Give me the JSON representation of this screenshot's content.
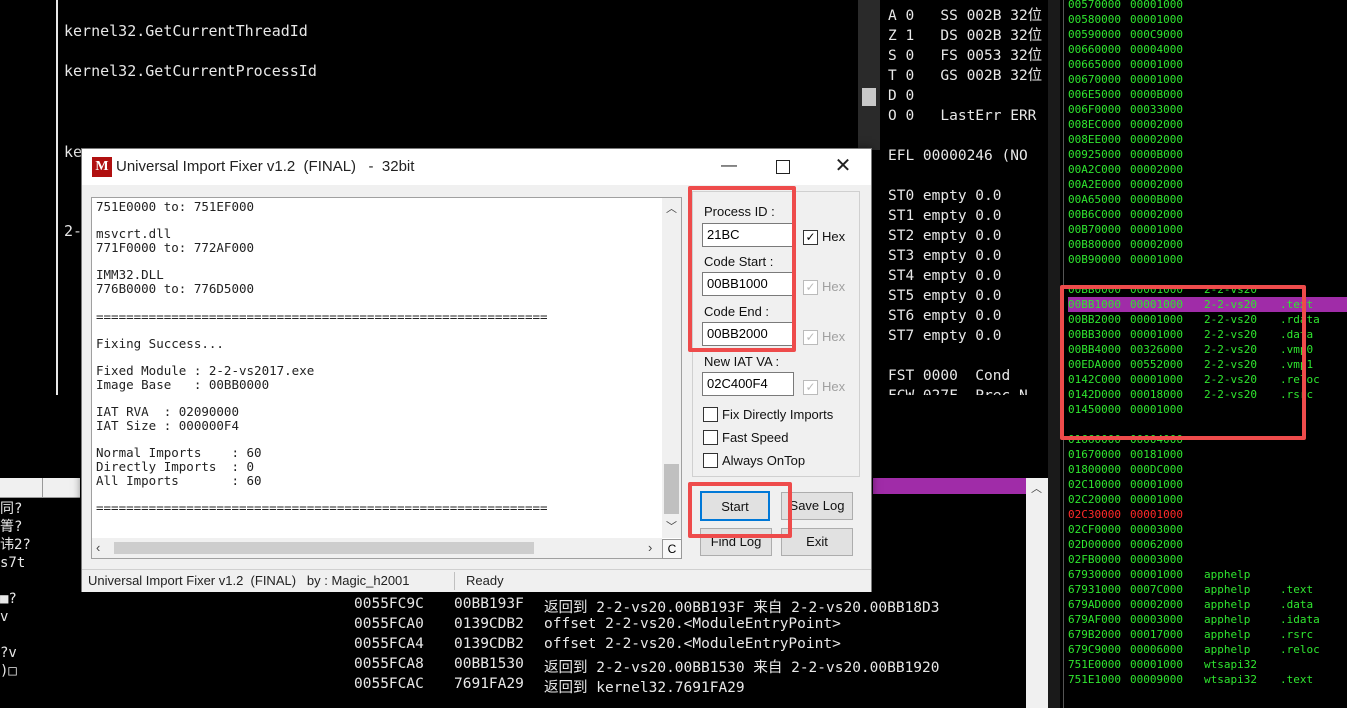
{
  "background": {
    "top_left_lines": [
      "kernel32.GetCurrentThreadId",
      "kernel32.GetCurrentProcessId"
    ],
    "partial_left": [
      "ke",
      "2-"
    ],
    "registers": [
      "A 0   SS 002B 32位",
      "Z 1   DS 002B 32位",
      "S 0   FS 0053 32位",
      "T 0   GS 002B 32位",
      "D 0",
      "O 0   LastErr ERR",
      "",
      "EFL 00000246 (NO",
      "",
      "ST0 empty 0.0",
      "ST1 empty 0.0",
      "ST2 empty 0.0",
      "ST3 empty 0.0",
      "ST4 empty 0.0",
      "ST5 empty 0.0",
      "ST6 empty 0.0",
      "ST7 empty 0.0",
      "",
      "FST 0000  Cond",
      "FCW 027F  Prec N"
    ],
    "stack_rows": [
      {
        "addr": "0055FC9C",
        "val": "00BB193F",
        "text": "返回到 2-2-vs20.00BB193F 来自 2-2-vs20.00BB18D3"
      },
      {
        "addr": "0055FCA0",
        "val": "0139CDB2",
        "text": "offset 2-2-vs20.<ModuleEntryPoint>"
      },
      {
        "addr": "0055FCA4",
        "val": "0139CDB2",
        "text": "offset 2-2-vs20.<ModuleEntryPoint>"
      },
      {
        "addr": "0055FCA8",
        "val": "00BB1530",
        "text": "返回到 2-2-vs20.00BB1530 来自 2-2-vs20.00BB1920"
      },
      {
        "addr": "0055FCAC",
        "val": "7691FA29",
        "text": "返回到 kernel32.7691FA29"
      }
    ],
    "left_bottom_chars": [
      "同?",
      "箐?",
      "讳2?",
      "s7t",
      "",
      "■?",
      "v",
      "",
      "?v",
      ")□"
    ],
    "memory_rows": [
      {
        "a": "00570000",
        "b": "00001000",
        "c": "",
        "d": ""
      },
      {
        "a": "00580000",
        "b": "00001000",
        "c": "",
        "d": ""
      },
      {
        "a": "00590000",
        "b": "000C9000",
        "c": "",
        "d": ""
      },
      {
        "a": "00660000",
        "b": "00004000",
        "c": "",
        "d": ""
      },
      {
        "a": "00665000",
        "b": "00001000",
        "c": "",
        "d": ""
      },
      {
        "a": "00670000",
        "b": "00001000",
        "c": "",
        "d": ""
      },
      {
        "a": "006E5000",
        "b": "0000B000",
        "c": "",
        "d": ""
      },
      {
        "a": "006F0000",
        "b": "00033000",
        "c": "",
        "d": ""
      },
      {
        "a": "008EC000",
        "b": "00002000",
        "c": "",
        "d": ""
      },
      {
        "a": "008EE000",
        "b": "00002000",
        "c": "",
        "d": ""
      },
      {
        "a": "00925000",
        "b": "0000B000",
        "c": "",
        "d": ""
      },
      {
        "a": "00A2C000",
        "b": "00002000",
        "c": "",
        "d": ""
      },
      {
        "a": "00A2E000",
        "b": "00002000",
        "c": "",
        "d": ""
      },
      {
        "a": "00A65000",
        "b": "0000B000",
        "c": "",
        "d": ""
      },
      {
        "a": "00B6C000",
        "b": "00002000",
        "c": "",
        "d": ""
      },
      {
        "a": "00B70000",
        "b": "00001000",
        "c": "",
        "d": ""
      },
      {
        "a": "00B80000",
        "b": "00002000",
        "c": "",
        "d": ""
      },
      {
        "a": "00B90000",
        "b": "00001000",
        "c": "",
        "d": ""
      },
      {
        "a": "",
        "b": "",
        "c": "",
        "d": ""
      },
      {
        "a": "00BB0000",
        "b": "00001000",
        "c": "2-2-vs20",
        "d": ""
      },
      {
        "a": "00BB1000",
        "b": "00001000",
        "c": "2-2-vs20",
        "d": ".text",
        "hl": true
      },
      {
        "a": "00BB2000",
        "b": "00001000",
        "c": "2-2-vs20",
        "d": ".rdata"
      },
      {
        "a": "00BB3000",
        "b": "00001000",
        "c": "2-2-vs20",
        "d": ".data"
      },
      {
        "a": "00BB4000",
        "b": "00326000",
        "c": "2-2-vs20",
        "d": ".vmp0"
      },
      {
        "a": "00EDA000",
        "b": "00552000",
        "c": "2-2-vs20",
        "d": ".vmp1"
      },
      {
        "a": "0142C000",
        "b": "00001000",
        "c": "2-2-vs20",
        "d": ".reloc"
      },
      {
        "a": "0142D000",
        "b": "00018000",
        "c": "2-2-vs20",
        "d": ".rsrc"
      },
      {
        "a": "01450000",
        "b": "00001000",
        "c": "",
        "d": ""
      },
      {
        "a": "",
        "b": "",
        "c": "",
        "d": ""
      },
      {
        "a": "01660000",
        "b": "00004000",
        "c": "",
        "d": ""
      },
      {
        "a": "01670000",
        "b": "00181000",
        "c": "",
        "d": ""
      },
      {
        "a": "01800000",
        "b": "000DC000",
        "c": "",
        "d": ""
      },
      {
        "a": "02C10000",
        "b": "00001000",
        "c": "",
        "d": ""
      },
      {
        "a": "02C20000",
        "b": "00001000",
        "c": "",
        "d": ""
      },
      {
        "a": "02C30000",
        "b": "00001000",
        "c": "",
        "d": "",
        "red": true
      },
      {
        "a": "02CF0000",
        "b": "00003000",
        "c": "",
        "d": ""
      },
      {
        "a": "02D00000",
        "b": "00062000",
        "c": "",
        "d": ""
      },
      {
        "a": "02FB0000",
        "b": "00003000",
        "c": "",
        "d": ""
      },
      {
        "a": "67930000",
        "b": "00001000",
        "c": "apphelp",
        "d": ""
      },
      {
        "a": "67931000",
        "b": "0007C000",
        "c": "apphelp",
        "d": ".text"
      },
      {
        "a": "679AD000",
        "b": "00002000",
        "c": "apphelp",
        "d": ".data"
      },
      {
        "a": "679AF000",
        "b": "00003000",
        "c": "apphelp",
        "d": ".idata"
      },
      {
        "a": "679B2000",
        "b": "00017000",
        "c": "apphelp",
        "d": ".rsrc"
      },
      {
        "a": "679C9000",
        "b": "00006000",
        "c": "apphelp",
        "d": ".reloc"
      },
      {
        "a": "751E0000",
        "b": "00001000",
        "c": "wtsapi32",
        "d": ""
      },
      {
        "a": "751E1000",
        "b": "00009000",
        "c": "wtsapi32",
        "d": ".text"
      }
    ]
  },
  "dialog": {
    "title": "Universal Import Fixer v1.2  (FINAL)   -  32bit",
    "log_lines": [
      "751E0000 to: 751EF000",
      "",
      "msvcrt.dll",
      "771F0000 to: 772AF000",
      "",
      "IMM32.DLL",
      "776B0000 to: 776D5000",
      "",
      "============================================================",
      "",
      "Fixing Success...",
      "",
      "Fixed Module : 2-2-vs2017.exe",
      "Image Base   : 00BB0000",
      "",
      "IAT RVA  : 02090000",
      "IAT Size : 000000F4",
      "",
      "Normal Imports    : 60",
      "Directly Imports  : 0",
      "All Imports       : 60",
      "",
      "============================================================"
    ],
    "fields": {
      "process_id_label": "Process ID :",
      "process_id_value": "21BC",
      "code_start_label": "Code Start :",
      "code_start_value": "00BB1000",
      "code_end_label": "Code End :",
      "code_end_value": "00BB2000",
      "new_iat_label": "New IAT VA :",
      "new_iat_value": "02C400F4",
      "hex_label": "Hex"
    },
    "options": {
      "fix_direct": "Fix Directly Imports",
      "fast_speed": "Fast Speed",
      "always_on_top": "Always OnTop"
    },
    "buttons": {
      "start": "Start",
      "save_log": "Save Log",
      "find_log": "Find Log",
      "exit": "Exit",
      "clear": "C"
    },
    "status": {
      "left": "Universal Import Fixer v1.2  (FINAL)   by : Magic_h2001",
      "right": "Ready"
    }
  },
  "colors": {
    "highlight_red": "#ee4b4b",
    "memory_green": "#2fe62f",
    "selection_purple": "#a02ca8"
  }
}
